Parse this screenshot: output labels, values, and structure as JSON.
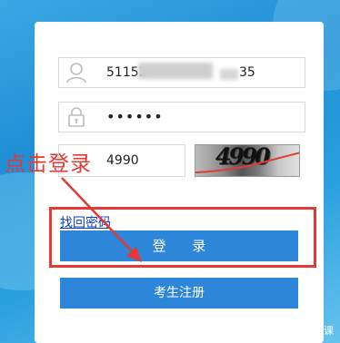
{
  "login": {
    "username_value": "51152",
    "username_tail": "35",
    "password_value": "••••••",
    "captcha_value": "4990",
    "captcha_image_text": "4990",
    "forgot_link": "找回密码",
    "login_button": "登 录",
    "register_button": "考生注册"
  },
  "annotation": {
    "tip_text": "点击登录",
    "color": "#e53935"
  },
  "watermark": {
    "text": "优思云课"
  },
  "colors": {
    "button": "#2d86d9",
    "link": "#0b3fc4"
  }
}
